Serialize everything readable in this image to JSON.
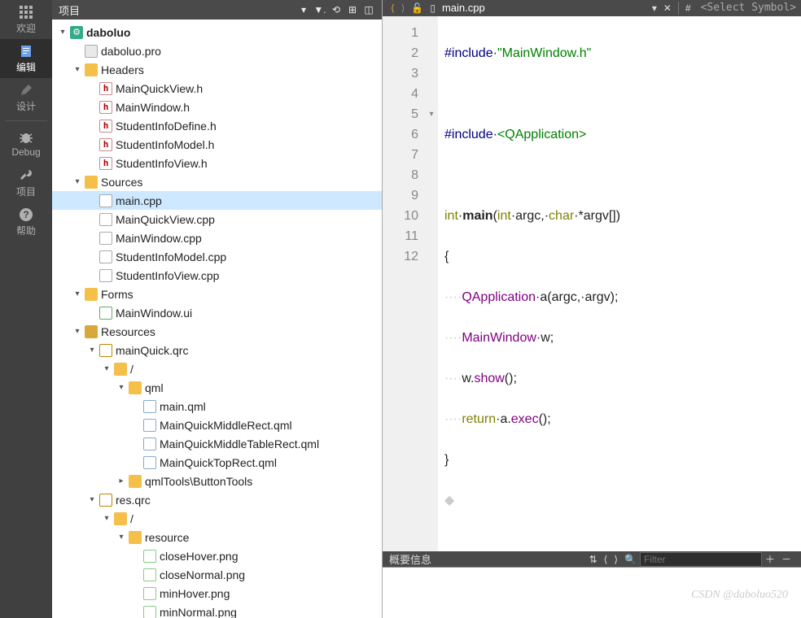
{
  "sidebar": {
    "items": [
      {
        "label": "欢迎",
        "icon": "grid"
      },
      {
        "label": "编辑",
        "icon": "document",
        "active": true
      },
      {
        "label": "设计",
        "icon": "pencil"
      },
      {
        "label": "Debug",
        "icon": "bug"
      },
      {
        "label": "项目",
        "icon": "wrench"
      },
      {
        "label": "帮助",
        "icon": "help"
      }
    ]
  },
  "projectPanel": {
    "title": "项目",
    "tree": {
      "root": "daboluo",
      "pro": "daboluo.pro",
      "headers": {
        "label": "Headers",
        "files": [
          "MainQuickView.h",
          "MainWindow.h",
          "StudentInfoDefine.h",
          "StudentInfoModel.h",
          "StudentInfoView.h"
        ]
      },
      "sources": {
        "label": "Sources",
        "files": [
          "main.cpp",
          "MainQuickView.cpp",
          "MainWindow.cpp",
          "StudentInfoModel.cpp",
          "StudentInfoView.cpp"
        ],
        "selected": "main.cpp"
      },
      "forms": {
        "label": "Forms",
        "files": [
          "MainWindow.ui"
        ]
      },
      "resources": {
        "label": "Resources",
        "mainQuick": {
          "label": "mainQuick.qrc",
          "rootDir": "/",
          "qml": {
            "label": "qml",
            "files": [
              "main.qml",
              "MainQuickMiddleRect.qml",
              "MainQuickMiddleTableRect.qml",
              "MainQuickTopRect.qml"
            ]
          },
          "tools": "qmlTools\\ButtonTools"
        },
        "res": {
          "label": "res.qrc",
          "rootDir": "/",
          "resource": {
            "label": "resource",
            "files": [
              "closeHover.png",
              "closeNormal.png",
              "minHover.png",
              "minNormal.png"
            ]
          }
        }
      }
    }
  },
  "editor": {
    "filename": "main.cpp",
    "symbolSelect": "<Select Symbol>",
    "lineNumbers": [
      "1",
      "2",
      "3",
      "4",
      "5",
      "6",
      "7",
      "8",
      "9",
      "10",
      "11",
      "12"
    ],
    "code": {
      "l1_inc": "#include",
      "l1_str": "\"MainWindow.h\"",
      "l3_inc": "#include",
      "l3_str": "<QApplication>",
      "l5_int": "int",
      "l5_main": "main",
      "l5_rest1": "(",
      "l5_int2": "int",
      "l5_argc": "argc,",
      "l5_char": "char",
      "l5_rest2": "*argv[])",
      "l6": "{",
      "l7_type": "QApplication",
      "l7_rest": "a(argc,",
      "l7_rest2": "argv);",
      "l8_type": "MainWindow",
      "l8_rest": "w;",
      "l9_w": "w.",
      "l9_show": "show",
      "l9_rest": "();",
      "l10_ret": "return",
      "l10_a": "a.",
      "l10_exec": "exec",
      "l10_rest": "();",
      "l11": "}",
      "dots": "····"
    }
  },
  "outline": {
    "title": "概要信息",
    "filterPlaceholder": "Filter"
  },
  "watermark": "CSDN @daboluo520"
}
